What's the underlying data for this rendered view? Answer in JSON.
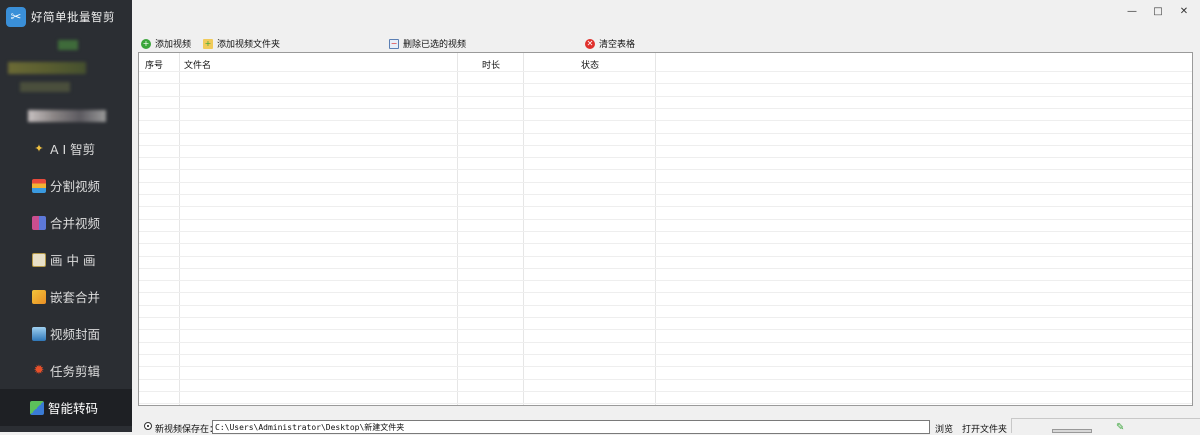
{
  "app": {
    "title": "好简单批量智剪"
  },
  "window": {
    "minimize_glyph": "—",
    "maximize_glyph": "□",
    "close_glyph": "✕"
  },
  "sidebar": {
    "items": [
      {
        "label": "A I 智剪",
        "icon": "ai-magic-icon",
        "active": false
      },
      {
        "label": "分割视频",
        "icon": "split-video-icon",
        "active": false
      },
      {
        "label": "合并视频",
        "icon": "merge-video-icon",
        "active": false
      },
      {
        "label": "画 中 画",
        "icon": "picture-in-picture-icon",
        "active": false
      },
      {
        "label": "嵌套合并",
        "icon": "nested-merge-icon",
        "active": false
      },
      {
        "label": "视频封面",
        "icon": "video-cover-icon",
        "active": false
      },
      {
        "label": "任务剪辑",
        "icon": "task-edit-icon",
        "active": false
      },
      {
        "label": "智能转码",
        "icon": "smart-transcode-icon",
        "active": true
      }
    ]
  },
  "toolbar": {
    "add_video": "添加视频",
    "add_folder": "添加视频文件夹",
    "remove_selected": "删除已选的视频",
    "clear_table": "清空表格"
  },
  "table": {
    "columns": [
      "序号",
      "文件名",
      "时长",
      "状态"
    ],
    "rows": []
  },
  "bottom": {
    "save_label": "新视频保存在：",
    "save_path": "C:\\Users\\Administrator\\Desktop\\新建文件夹",
    "browse": "浏览",
    "open_folder": "打开文件夹"
  },
  "colors": {
    "sidebar_bg": "#2b2e33",
    "sidebar_active_bg": "#1e2024",
    "add_icon": "#3aa53a",
    "clear_icon": "#e0302c",
    "logo": "#3a8fd8"
  }
}
